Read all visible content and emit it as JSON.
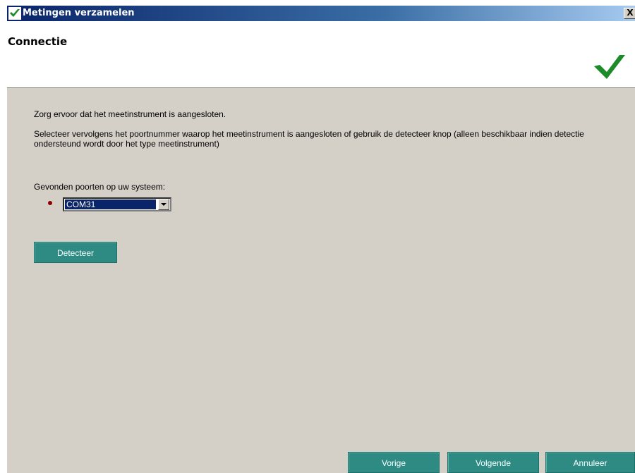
{
  "window": {
    "title": "Metingen verzamelen",
    "close_label": "X"
  },
  "header": {
    "title": "Connectie"
  },
  "content": {
    "line1": "Zorg ervoor dat het meetinstrument is aangesloten.",
    "line2": "Selecteer vervolgens het poortnummer waarop het meetinstrument is aangesloten of gebruik de detecteer knop (alleen beschikbaar indien detectie ondersteund wordt door het type meetinstrument)",
    "ports_label": "Gevonden poorten op uw systeem:",
    "port_selected": "COM31"
  },
  "buttons": {
    "detect": "Detecteer",
    "previous": "Vorige",
    "next": "Volgende",
    "cancel": "Annuleer"
  },
  "colors": {
    "button_teal": "#2e8b84",
    "check_green": "#1e8b2a",
    "selection_blue": "#0a246a",
    "status_dot": "#8b0000"
  }
}
